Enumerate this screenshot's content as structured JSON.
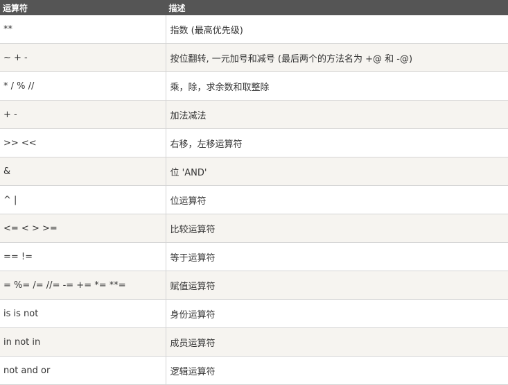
{
  "table": {
    "headers": [
      "运算符",
      "描述"
    ],
    "rows": [
      {
        "op": "**",
        "desc": "指数 (最高优先级)"
      },
      {
        "op": "~ + -",
        "desc": "按位翻转, 一元加号和减号 (最后两个的方法名为 +@ 和 -@)"
      },
      {
        "op": "* / % //",
        "desc": "乘，除，求余数和取整除"
      },
      {
        "op": "+ -",
        "desc": "加法减法"
      },
      {
        "op": ">> <<",
        "desc": "右移，左移运算符"
      },
      {
        "op": "&",
        "desc": "位 'AND'"
      },
      {
        "op": "^ |",
        "desc": "位运算符"
      },
      {
        "op": "<= < > >=",
        "desc": "比较运算符"
      },
      {
        "op": "== !=",
        "desc": "等于运算符"
      },
      {
        "op": "= %= /= //= -= += *= **=",
        "desc": "赋值运算符"
      },
      {
        "op": "is is not",
        "desc": "身份运算符"
      },
      {
        "op": "in not in",
        "desc": "成员运算符"
      },
      {
        "op": "not and or",
        "desc": "逻辑运算符"
      }
    ]
  },
  "colors": {
    "header_bg": "#555555",
    "header_text": "#ffffff",
    "row_alt_bg": "#f6f4f0",
    "border": "#d4d4d4"
  }
}
